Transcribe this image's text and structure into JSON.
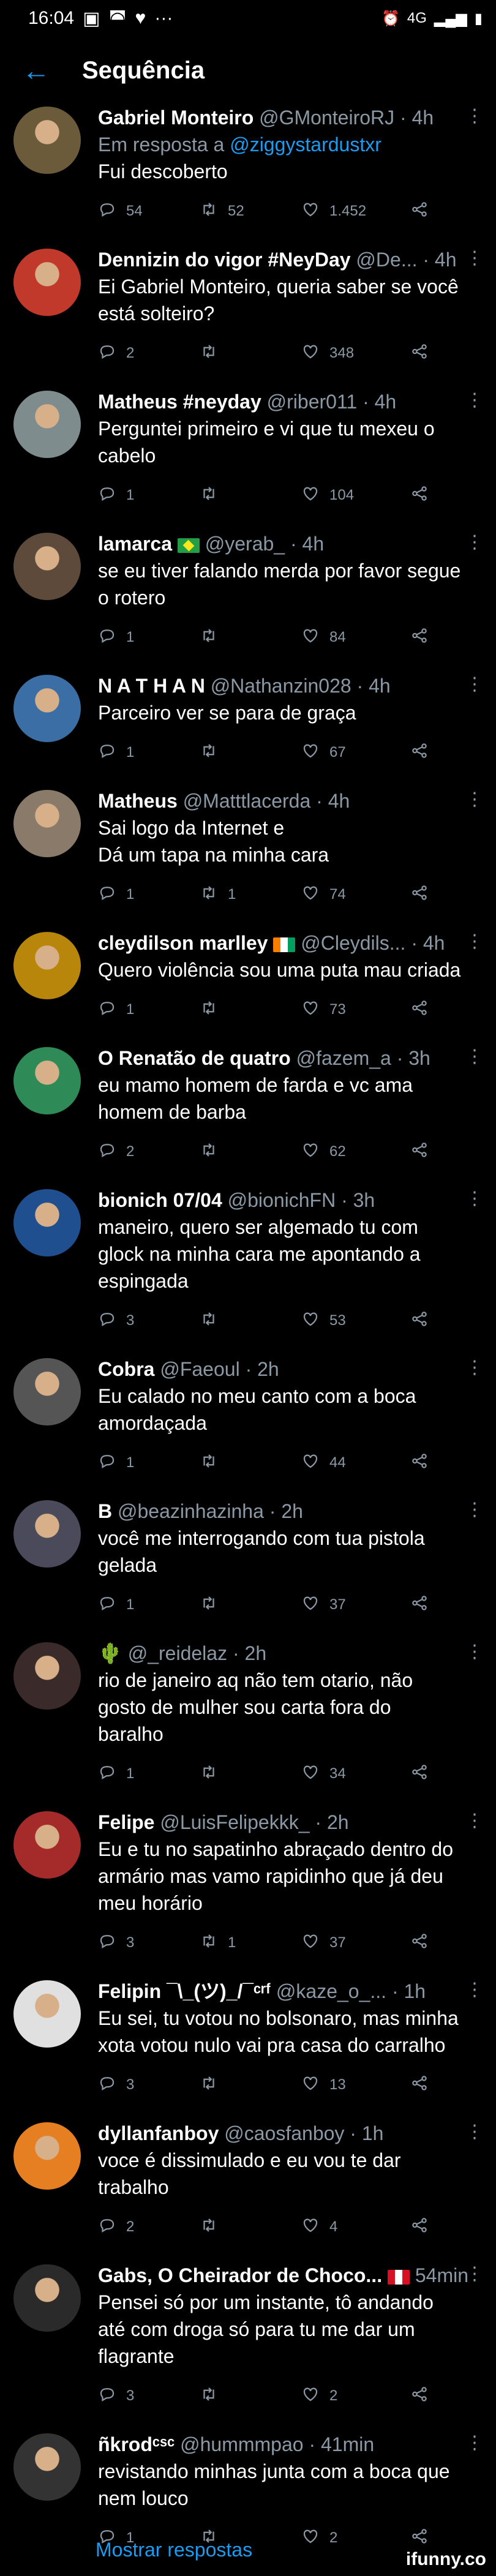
{
  "status": {
    "time": "16:04",
    "ellipsis": "···",
    "net": "4G"
  },
  "header": {
    "title": "Sequência"
  },
  "tweets": [
    {
      "name": "Gabriel Monteiro",
      "handle": "@GMonteiroRJ · 4h",
      "reply_prefix": "Em resposta a ",
      "reply_to": "@ziggystardustxr",
      "text": "Fui descoberto",
      "replies": "54",
      "retweets": "52",
      "likes": "1.452",
      "avatar_color": "#6b5b3a"
    },
    {
      "name": "Dennizin do vigor #NeyDay",
      "handle": "@De... · 4h",
      "text": "Ei Gabriel Monteiro, queria saber se você\nestá solteiro?",
      "replies": "2",
      "retweets": "",
      "likes": "348",
      "avatar_color": "#c0392b"
    },
    {
      "name": "Matheus #neyday",
      "handle": "@riber011 · 4h",
      "text": "Perguntei primeiro e vi que tu mexeu o\ncabelo",
      "replies": "1",
      "retweets": "",
      "likes": "104",
      "avatar_color": "#7f8c8d"
    },
    {
      "name": "lamarca",
      "handle": "@yerab_ · 4h",
      "text": "se eu tiver falando merda por favor segue\no rotero",
      "replies": "1",
      "retweets": "",
      "likes": "84",
      "avatar_color": "#5d4a3a",
      "flag": "br"
    },
    {
      "name": "N A T H A N",
      "handle": "@Nathanzin028 · 4h",
      "text": "Parceiro ver se para de graça",
      "replies": "1",
      "retweets": "",
      "likes": "67",
      "avatar_color": "#3a6ea5"
    },
    {
      "name": "Matheus",
      "handle": "@Matttlacerda · 4h",
      "text": "Sai logo da Internet e\nDá um tapa na minha cara",
      "replies": "1",
      "retweets": "1",
      "likes": "74",
      "avatar_color": "#8a7a6a"
    },
    {
      "name": "cleydilson marlley",
      "handle": "@Cleydils... · 4h",
      "text": "Quero violência sou uma puta mau criada",
      "replies": "1",
      "retweets": "",
      "likes": "73",
      "avatar_color": "#b8860b",
      "flag": "ci"
    },
    {
      "name": "O Renatão de quatro",
      "handle": "@fazem_a · 3h",
      "text": "eu mamo homem de farda e vc ama\nhomem de barba",
      "replies": "2",
      "retweets": "",
      "likes": "62",
      "avatar_color": "#2e8b57"
    },
    {
      "name": "bionich 07/04",
      "handle": "@bionichFN · 3h",
      "text": "maneiro, quero ser algemado tu com\nglock na minha cara me apontando a\nespingada",
      "replies": "3",
      "retweets": "",
      "likes": "53",
      "avatar_color": "#1f4f8f"
    },
    {
      "name": "Cobra",
      "handle": "@Faeoul · 2h",
      "text": "Eu calado no meu canto com a boca\namordaçada",
      "replies": "1",
      "retweets": "",
      "likes": "44",
      "avatar_color": "#555"
    },
    {
      "name": "B",
      "handle": "@beazinhazinha · 2h",
      "text": "você me interrogando com tua pistola\ngelada",
      "replies": "1",
      "retweets": "",
      "likes": "37",
      "avatar_color": "#4a4a5a"
    },
    {
      "name": "🌵",
      "handle": "@_reidelaz · 2h",
      "text": "rio de janeiro aq não tem otario, não\ngosto de mulher sou carta fora do\nbaralho",
      "replies": "1",
      "retweets": "",
      "likes": "34",
      "avatar_color": "#3a2a2a"
    },
    {
      "name": "Felipe",
      "handle": "@LuisFelipekkk_ · 2h",
      "text": "Eu e tu no sapatinho abraçado dentro do\narmário mas vamo rapidinho que já deu\nmeu horário",
      "replies": "3",
      "retweets": "1",
      "likes": "37",
      "avatar_color": "#a52a2a"
    },
    {
      "name": "Felipin ¯\\_(ツ)_/¯ᶜʳᶠ",
      "handle": "@kaze_o_... · 1h",
      "text": "Eu sei, tu votou no bolsonaro, mas minha\nxota votou nulo vai pra casa do carralho",
      "replies": "3",
      "retweets": "",
      "likes": "13",
      "avatar_color": "#e0e0e0"
    },
    {
      "name": "dyllanfanboy",
      "handle": "@caosfanboy · 1h",
      "text": "voce é dissimulado e eu vou te dar\ntrabalho",
      "replies": "2",
      "retweets": "",
      "likes": "4",
      "avatar_color": "#e67e22"
    },
    {
      "name": "Gabs, O Cheirador de Choco...",
      "handle": "54min",
      "text": "Pensei só por um instante, tô andando\naté com droga só para tu me dar um\nflagrante",
      "replies": "3",
      "retweets": "",
      "likes": "2",
      "avatar_color": "#2a2a2a",
      "flag": "pe"
    },
    {
      "name": "ñkrodᶜˢᶜ",
      "handle": "@hummmpao · 41min",
      "text": "revistando minhas junta com a boca que\nnem louco",
      "replies": "1",
      "retweets": "",
      "likes": "2",
      "avatar_color": "#333"
    }
  ],
  "footer": {
    "show_more": "Mostrar respostas",
    "watermark": "ifunny.co"
  }
}
